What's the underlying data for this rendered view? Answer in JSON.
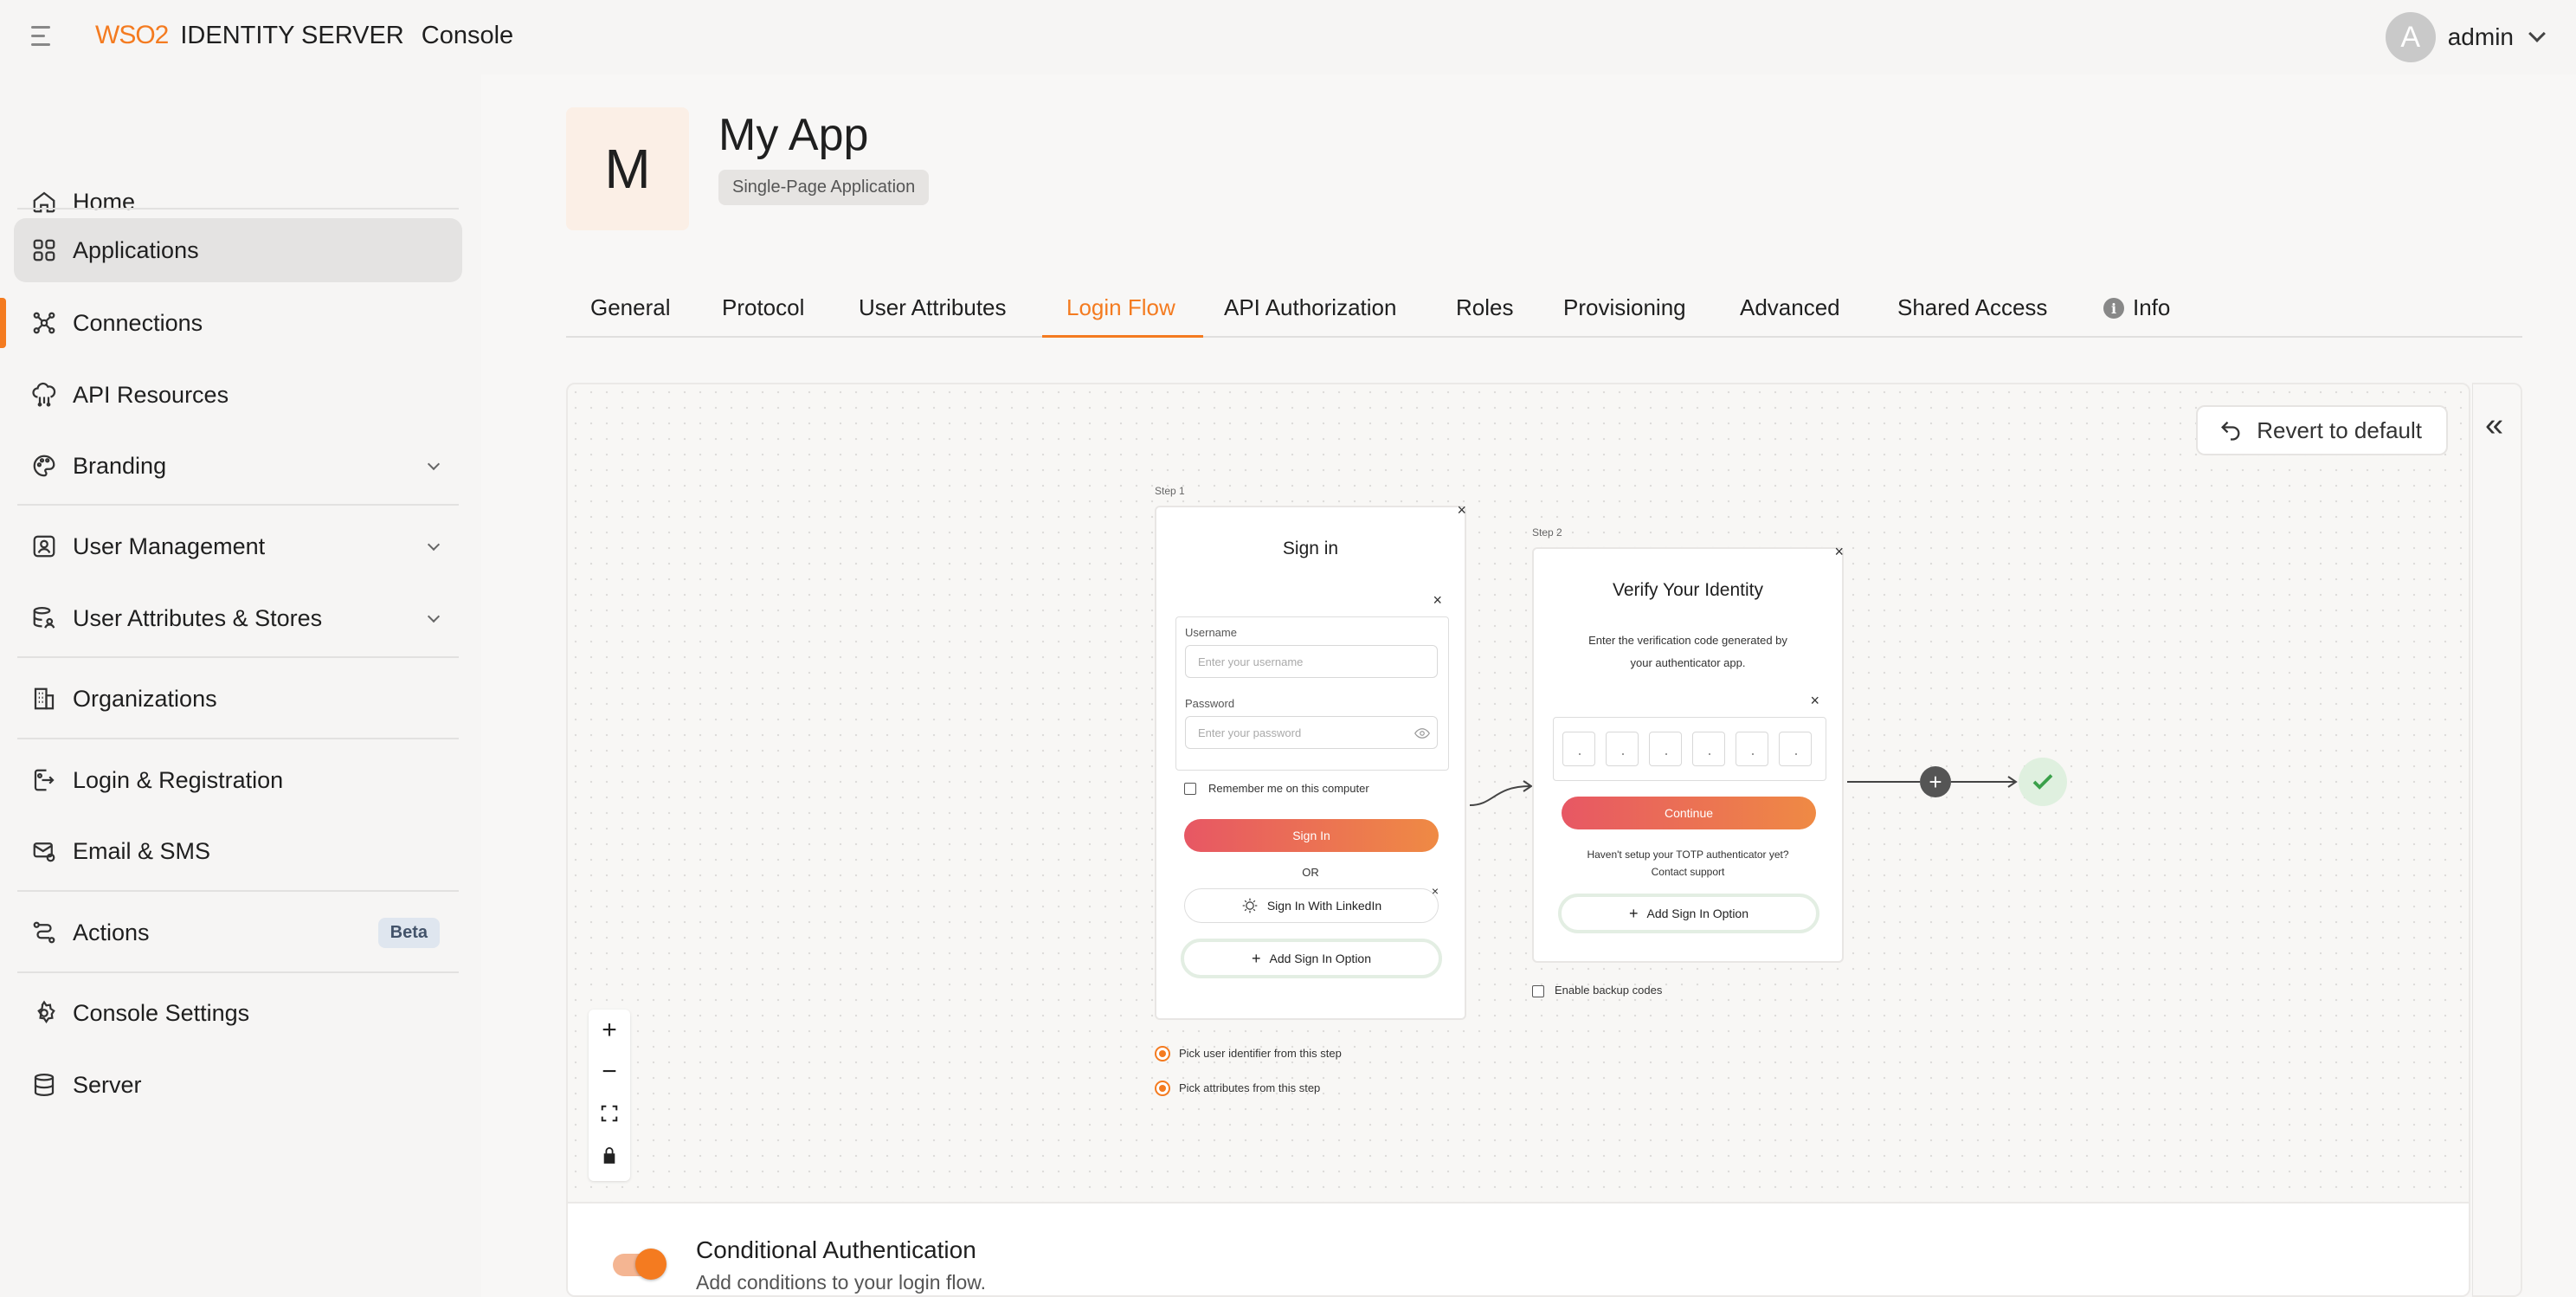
{
  "header": {
    "logo_wso2": "WSO2",
    "logo_product": "IDENTITY SERVER",
    "logo_console": "Console",
    "user_initial": "A",
    "user_name": "admin"
  },
  "sidebar": {
    "items": [
      {
        "label": "Home",
        "icon": "home-icon"
      },
      {
        "label": "Applications",
        "icon": "applications-icon"
      },
      {
        "label": "Connections",
        "icon": "connections-icon"
      },
      {
        "label": "API Resources",
        "icon": "api-resources-icon"
      },
      {
        "label": "Branding",
        "icon": "branding-icon"
      },
      {
        "label": "User Management",
        "icon": "user-management-icon"
      },
      {
        "label": "User Attributes & Stores",
        "icon": "user-attributes-icon"
      },
      {
        "label": "Organizations",
        "icon": "organizations-icon"
      },
      {
        "label": "Login & Registration",
        "icon": "login-registration-icon"
      },
      {
        "label": "Email & SMS",
        "icon": "email-sms-icon"
      },
      {
        "label": "Actions",
        "icon": "actions-icon",
        "badge": "Beta"
      },
      {
        "label": "Console Settings",
        "icon": "console-settings-icon"
      },
      {
        "label": "Server",
        "icon": "server-icon"
      }
    ],
    "active": "Applications"
  },
  "app": {
    "initial": "M",
    "title": "My App",
    "type": "Single-Page Application"
  },
  "tabs": [
    "General",
    "Protocol",
    "User Attributes",
    "Login Flow",
    "API Authorization",
    "Roles",
    "Provisioning",
    "Advanced",
    "Shared Access",
    "Info"
  ],
  "active_tab": "Login Flow",
  "canvas": {
    "revert_label": "Revert to default",
    "step1": {
      "label": "Step 1",
      "title": "Sign in",
      "username_label": "Username",
      "username_placeholder": "Enter your username",
      "password_label": "Password",
      "password_placeholder": "Enter your password",
      "remember_label": "Remember me on this computer",
      "signin_button": "Sign In",
      "or_text": "OR",
      "linkedin_button": "Sign In With LinkedIn",
      "add_option": "Add Sign In Option",
      "pick_identifier": "Pick user identifier from this step",
      "pick_attributes": "Pick attributes from this step"
    },
    "step2": {
      "label": "Step 2",
      "title": "Verify Your Identity",
      "description_line1": "Enter the verification code generated by",
      "description_line2": "your authenticator app.",
      "continue_button": "Continue",
      "help_line1": "Haven't setup your TOTP authenticator yet?",
      "help_line2": "Contact support",
      "add_option": "Add Sign In Option",
      "backup_codes": "Enable backup codes"
    },
    "conditional": {
      "title": "Conditional Authentication",
      "subtitle": "Add conditions to your login flow."
    }
  },
  "colors": {
    "accent": "#f47b20",
    "active_nav_bg": "#e4e3e2",
    "success": "#3aa04a"
  }
}
